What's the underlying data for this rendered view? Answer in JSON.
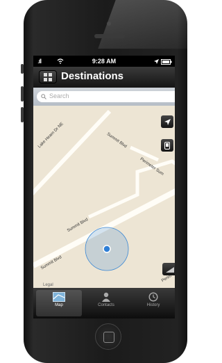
{
  "status_bar": {
    "signal": ".ıll",
    "wifi_icon": "wifi-icon",
    "time": "9:28 AM",
    "location_icon": "arrow",
    "battery_icon": "battery-icon"
  },
  "nav": {
    "title": "Destinations",
    "menu_icon": "grid-icon"
  },
  "search": {
    "placeholder": "Search"
  },
  "map": {
    "streets": [
      "Lake Hearn Dr NE",
      "Summit Blvd",
      "Perimeter Sum",
      "Summit Blvd",
      "Summit Blvd",
      "Perim"
    ],
    "legal": "Legal",
    "accent": "#3a87d4"
  },
  "tabs": [
    {
      "label": "Map",
      "icon": "map-icon",
      "active": true
    },
    {
      "label": "Contacts",
      "icon": "person-icon",
      "active": false
    },
    {
      "label": "History",
      "icon": "clock-icon",
      "active": false
    }
  ]
}
